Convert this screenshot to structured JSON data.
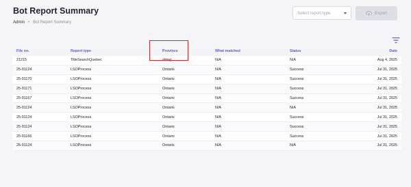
{
  "header": {
    "title": "Bot Report Summary",
    "breadcrumb": [
      "Admin",
      "Bot Report Summary"
    ]
  },
  "toolbar": {
    "select_placeholder": "Select report type",
    "export_label": "Export"
  },
  "table": {
    "columns": [
      "File no.",
      "Report type",
      "Province",
      "What matched",
      "Status",
      "Date"
    ],
    "rows": [
      [
        "21215",
        "TitleSearchQuebec",
        "string",
        "N/A",
        "N/A",
        "Aug 4, 2025"
      ],
      [
        "25-91124",
        "LSOProcess",
        "Ontario",
        "N/A",
        "Success",
        "Jul 31, 2025"
      ],
      [
        "25-91170",
        "LSOProcess",
        "Ontario",
        "N/A",
        "Success",
        "Jul 31, 2025"
      ],
      [
        "25-91171",
        "LSOProcess",
        "Ontario",
        "N/A",
        "Success",
        "Jul 31, 2025"
      ],
      [
        "25-91167",
        "LSOProcess",
        "Ontario",
        "N/A",
        "Success",
        "Jul 31, 2025"
      ],
      [
        "25-91124",
        "LSOProcess",
        "Ontario",
        "N/A",
        "N/A",
        "Jul 31, 2025"
      ],
      [
        "25-91124",
        "LSOProcess",
        "Ontario",
        "N/A",
        "Success",
        "Jul 31, 2025"
      ],
      [
        "25-91124",
        "LSOProcess",
        "Ontario",
        "N/A",
        "Success",
        "Jul 31, 2025"
      ],
      [
        "25-91166",
        "LSOProcess",
        "Ontario",
        "N/A",
        "Success",
        "Jul 31, 2025"
      ],
      [
        "25-91124",
        "LSOProcess",
        "Ontario",
        "N/A",
        "N/A",
        "Jul 31, 2025"
      ]
    ]
  },
  "colors": {
    "accent": "#5b5bd6",
    "highlight": "#e02424"
  },
  "icons": {
    "filter": "filter-icon",
    "export": "cloud-download-icon",
    "dropdown": "chevron-down-icon"
  }
}
